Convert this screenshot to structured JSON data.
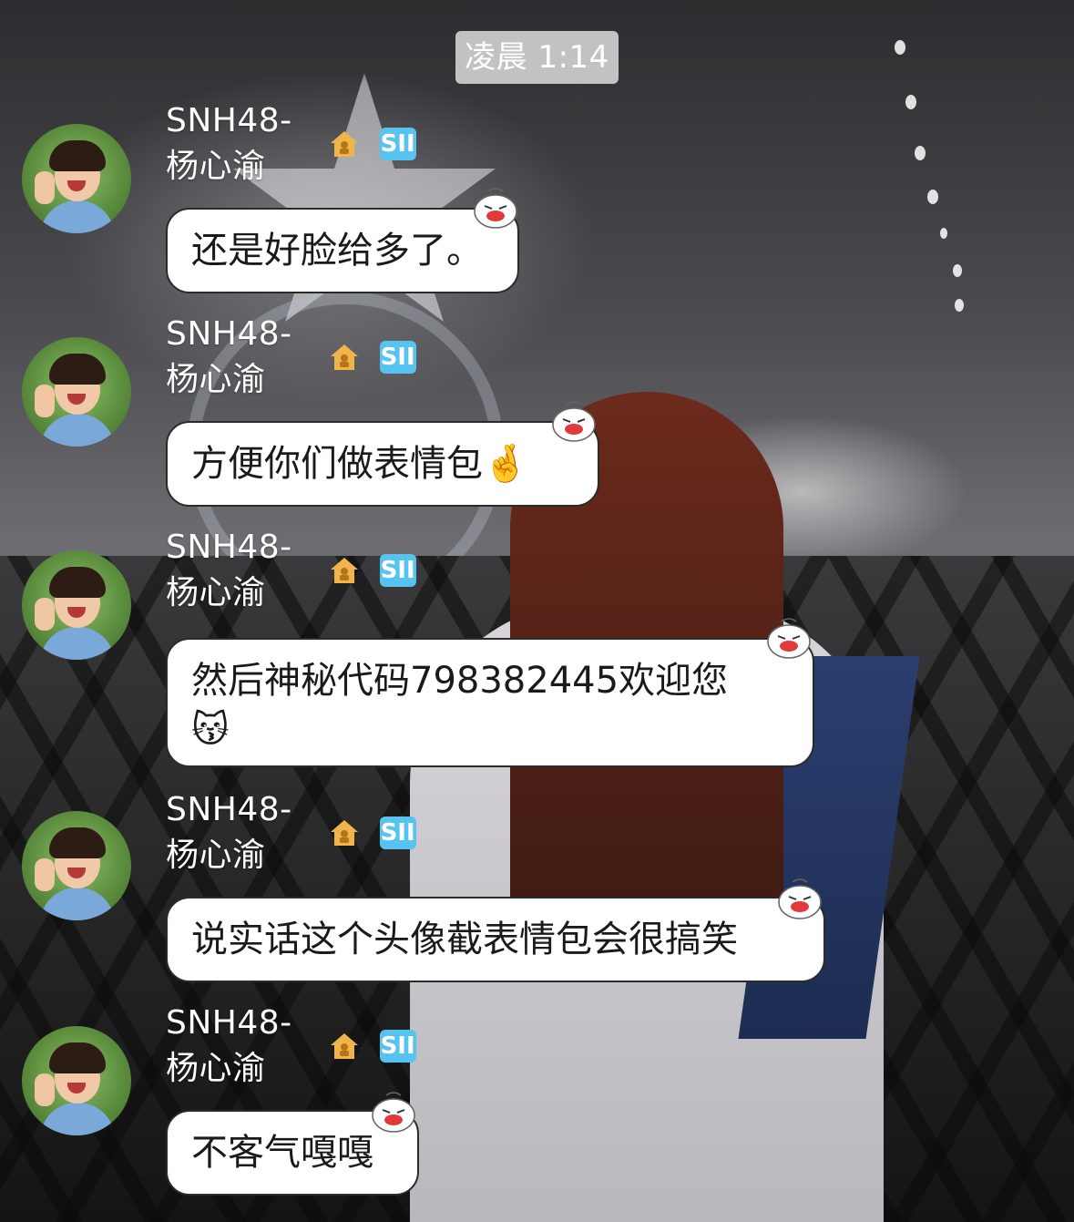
{
  "timestamp": "凌晨 1:14",
  "messages": [
    {
      "sender": "SNH48-杨心渝",
      "team": "SII",
      "text": "还是好脸给多了。"
    },
    {
      "sender": "SNH48-杨心渝",
      "team": "SII",
      "text": "方便你们做表情包🤞"
    },
    {
      "sender": "SNH48-杨心渝",
      "team": "SII",
      "text": "然后神秘代码798382445欢迎您\n😽"
    },
    {
      "sender": "SNH48-杨心渝",
      "team": "SII",
      "text": "说实话这个头像截表情包会很搞笑"
    },
    {
      "sender": "SNH48-杨心渝",
      "team": "SII",
      "text": "不客气嘎嘎"
    }
  ],
  "icons": {
    "house": "house-icon",
    "bubble_sticker": "laughing-bun-sticker"
  },
  "colors": {
    "team_badge": "#56c3f0",
    "bubble_bg": "#ffffff",
    "bubble_border": "#2a2a2a",
    "name_text": "#ffffff",
    "timestamp_pill": "#dcdcde"
  }
}
